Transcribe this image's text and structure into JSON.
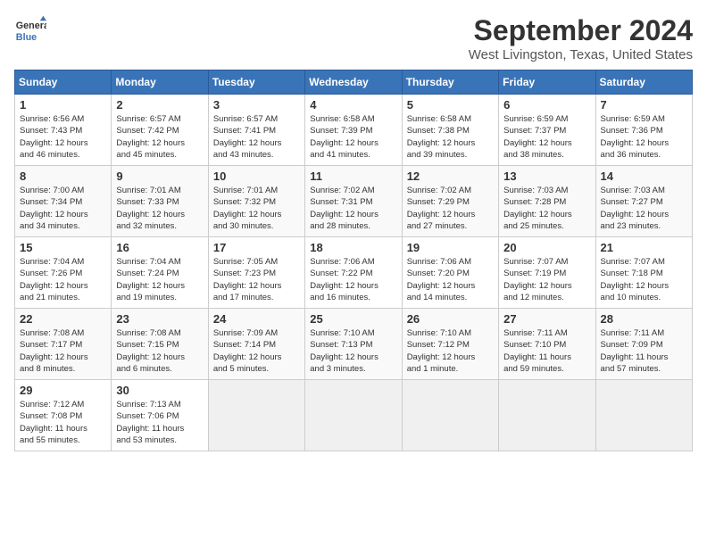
{
  "header": {
    "logo_line1": "General",
    "logo_line2": "Blue",
    "month": "September 2024",
    "location": "West Livingston, Texas, United States"
  },
  "weekdays": [
    "Sunday",
    "Monday",
    "Tuesday",
    "Wednesday",
    "Thursday",
    "Friday",
    "Saturday"
  ],
  "weeks": [
    [
      {
        "day": "1",
        "info": "Sunrise: 6:56 AM\nSunset: 7:43 PM\nDaylight: 12 hours\nand 46 minutes."
      },
      {
        "day": "2",
        "info": "Sunrise: 6:57 AM\nSunset: 7:42 PM\nDaylight: 12 hours\nand 45 minutes."
      },
      {
        "day": "3",
        "info": "Sunrise: 6:57 AM\nSunset: 7:41 PM\nDaylight: 12 hours\nand 43 minutes."
      },
      {
        "day": "4",
        "info": "Sunrise: 6:58 AM\nSunset: 7:39 PM\nDaylight: 12 hours\nand 41 minutes."
      },
      {
        "day": "5",
        "info": "Sunrise: 6:58 AM\nSunset: 7:38 PM\nDaylight: 12 hours\nand 39 minutes."
      },
      {
        "day": "6",
        "info": "Sunrise: 6:59 AM\nSunset: 7:37 PM\nDaylight: 12 hours\nand 38 minutes."
      },
      {
        "day": "7",
        "info": "Sunrise: 6:59 AM\nSunset: 7:36 PM\nDaylight: 12 hours\nand 36 minutes."
      }
    ],
    [
      {
        "day": "8",
        "info": "Sunrise: 7:00 AM\nSunset: 7:34 PM\nDaylight: 12 hours\nand 34 minutes."
      },
      {
        "day": "9",
        "info": "Sunrise: 7:01 AM\nSunset: 7:33 PM\nDaylight: 12 hours\nand 32 minutes."
      },
      {
        "day": "10",
        "info": "Sunrise: 7:01 AM\nSunset: 7:32 PM\nDaylight: 12 hours\nand 30 minutes."
      },
      {
        "day": "11",
        "info": "Sunrise: 7:02 AM\nSunset: 7:31 PM\nDaylight: 12 hours\nand 28 minutes."
      },
      {
        "day": "12",
        "info": "Sunrise: 7:02 AM\nSunset: 7:29 PM\nDaylight: 12 hours\nand 27 minutes."
      },
      {
        "day": "13",
        "info": "Sunrise: 7:03 AM\nSunset: 7:28 PM\nDaylight: 12 hours\nand 25 minutes."
      },
      {
        "day": "14",
        "info": "Sunrise: 7:03 AM\nSunset: 7:27 PM\nDaylight: 12 hours\nand 23 minutes."
      }
    ],
    [
      {
        "day": "15",
        "info": "Sunrise: 7:04 AM\nSunset: 7:26 PM\nDaylight: 12 hours\nand 21 minutes."
      },
      {
        "day": "16",
        "info": "Sunrise: 7:04 AM\nSunset: 7:24 PM\nDaylight: 12 hours\nand 19 minutes."
      },
      {
        "day": "17",
        "info": "Sunrise: 7:05 AM\nSunset: 7:23 PM\nDaylight: 12 hours\nand 17 minutes."
      },
      {
        "day": "18",
        "info": "Sunrise: 7:06 AM\nSunset: 7:22 PM\nDaylight: 12 hours\nand 16 minutes."
      },
      {
        "day": "19",
        "info": "Sunrise: 7:06 AM\nSunset: 7:20 PM\nDaylight: 12 hours\nand 14 minutes."
      },
      {
        "day": "20",
        "info": "Sunrise: 7:07 AM\nSunset: 7:19 PM\nDaylight: 12 hours\nand 12 minutes."
      },
      {
        "day": "21",
        "info": "Sunrise: 7:07 AM\nSunset: 7:18 PM\nDaylight: 12 hours\nand 10 minutes."
      }
    ],
    [
      {
        "day": "22",
        "info": "Sunrise: 7:08 AM\nSunset: 7:17 PM\nDaylight: 12 hours\nand 8 minutes."
      },
      {
        "day": "23",
        "info": "Sunrise: 7:08 AM\nSunset: 7:15 PM\nDaylight: 12 hours\nand 6 minutes."
      },
      {
        "day": "24",
        "info": "Sunrise: 7:09 AM\nSunset: 7:14 PM\nDaylight: 12 hours\nand 5 minutes."
      },
      {
        "day": "25",
        "info": "Sunrise: 7:10 AM\nSunset: 7:13 PM\nDaylight: 12 hours\nand 3 minutes."
      },
      {
        "day": "26",
        "info": "Sunrise: 7:10 AM\nSunset: 7:12 PM\nDaylight: 12 hours\nand 1 minute."
      },
      {
        "day": "27",
        "info": "Sunrise: 7:11 AM\nSunset: 7:10 PM\nDaylight: 11 hours\nand 59 minutes."
      },
      {
        "day": "28",
        "info": "Sunrise: 7:11 AM\nSunset: 7:09 PM\nDaylight: 11 hours\nand 57 minutes."
      }
    ],
    [
      {
        "day": "29",
        "info": "Sunrise: 7:12 AM\nSunset: 7:08 PM\nDaylight: 11 hours\nand 55 minutes."
      },
      {
        "day": "30",
        "info": "Sunrise: 7:13 AM\nSunset: 7:06 PM\nDaylight: 11 hours\nand 53 minutes."
      },
      {
        "day": "",
        "info": ""
      },
      {
        "day": "",
        "info": ""
      },
      {
        "day": "",
        "info": ""
      },
      {
        "day": "",
        "info": ""
      },
      {
        "day": "",
        "info": ""
      }
    ]
  ]
}
